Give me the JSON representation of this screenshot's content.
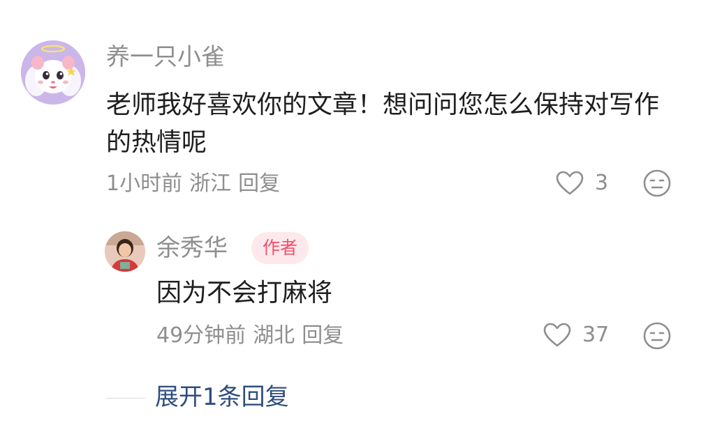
{
  "comment": {
    "username": "养一只小雀",
    "avatar_icon": "cartoon-hamster-angel-avatar",
    "text": "老师我好喜欢你的文章！想问问您怎么保持对写作的热情呢",
    "time": "1小时前",
    "location": "浙江",
    "reply_label": "回复",
    "like_count": "3"
  },
  "reply": {
    "username": "余秀华",
    "author_badge": "作者",
    "avatar_icon": "person-portrait-avatar",
    "text": "因为不会打麻将",
    "time": "49分钟前",
    "location": "湖北",
    "reply_label": "回复",
    "like_count": "37"
  },
  "expand_label": "展开1条回复",
  "colors": {
    "meta_gray": "#8e8e8e",
    "text_dark": "#1e1e1e",
    "author_badge_text": "#f0506a",
    "author_badge_bg": "#fde9ec",
    "expand_link": "#2f4d7e"
  }
}
